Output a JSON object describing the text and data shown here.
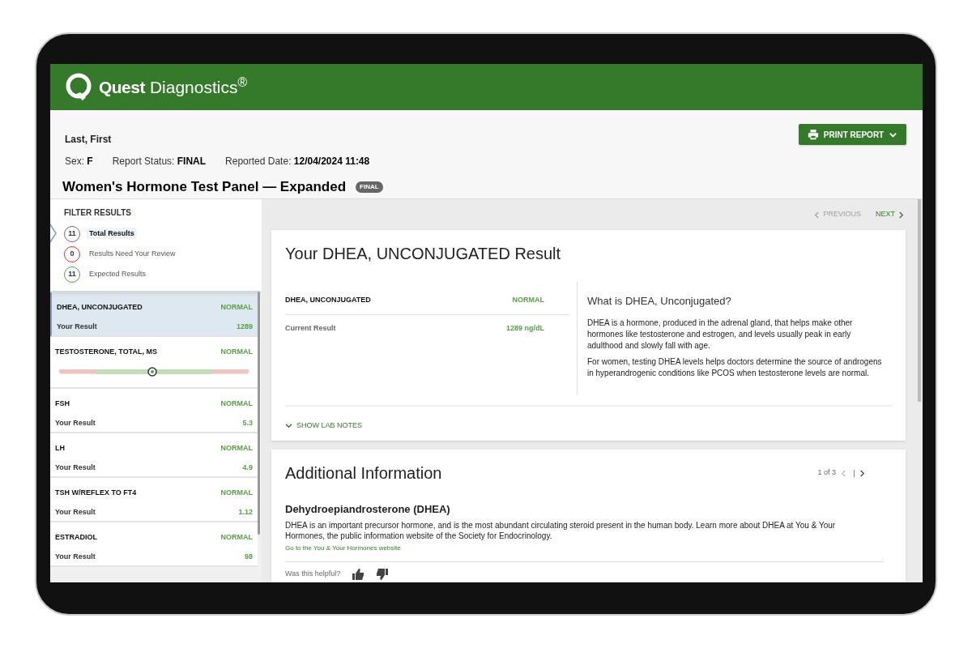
{
  "header": {
    "brand_bold": "Quest",
    "brand_light": "Diagnostics$^{®}$"
  },
  "patient": {
    "name": "Last, First",
    "fields": [
      {
        "label": "Sex:",
        "value": "F"
      },
      {
        "label": "Report Status:",
        "value": "FINAL"
      },
      {
        "label": "Reported Date:",
        "value": "12/04/2024 11:48"
      }
    ],
    "print_button": "PRINT REPORT",
    "title": "Women's Hormone Test Panel — Expanded",
    "badge": "FINAL"
  },
  "filter": {
    "heading": "FILTER RESULTS",
    "items": [
      {
        "count": "11",
        "label": "Total Results",
        "color": "#6b6b6b",
        "selected": true
      },
      {
        "count": "0",
        "label": "Results Need Your Review",
        "color": "#d32f2f",
        "selected": false
      },
      {
        "count": "11",
        "label": "Expected Results",
        "color": "#5a9e47",
        "selected": false
      }
    ]
  },
  "results": [
    {
      "kind": "value",
      "name": "DHEA, UNCONJUGATED",
      "status": "NORMAL",
      "label": "Your Result",
      "value": "1289",
      "selected": true
    },
    {
      "kind": "range",
      "name": "TESTOSTERONE, TOTAL, MS",
      "status": "NORMAL",
      "level": 0.49,
      "selected": false
    },
    {
      "kind": "value",
      "name": "FSH",
      "status": "NORMAL",
      "label": "Your Result",
      "value": "5.3",
      "selected": false
    },
    {
      "kind": "value",
      "name": "LH",
      "status": "NORMAL",
      "label": "Your Result",
      "value": "4.9",
      "selected": false
    },
    {
      "kind": "value",
      "name": "TSH W/REFLEX TO FT4",
      "status": "NORMAL",
      "label": "Your Result",
      "value": "1.12",
      "selected": false
    },
    {
      "kind": "value",
      "name": "ESTRADIOL",
      "status": "NORMAL",
      "label": "Your Result",
      "value": "98",
      "selected": false
    }
  ],
  "nav": {
    "previous": {
      "label": "PREVIOUS",
      "disabled": true
    },
    "next": {
      "label": "NEXT",
      "disabled": false
    }
  },
  "result_card": {
    "title": "Your DHEA, UNCONJUGATED Result",
    "test_name": "DHEA, UNCONJUGATED",
    "status": "NORMAL",
    "current_label": "Current Result",
    "current_value": "1289 ng/dL",
    "info_title": "What is DHEA, Unconjugated?",
    "paragraphs": [
      "DHEA is a hormone, produced in the adrenal gland, that helps make other hormones like testosterone and estrogen, and levels usually peak in early adulthood and slowly fall with age.",
      "For women, testing DHEA levels helps doctors determine the source of androgens in hyperandrogenic conditions like PCOS when testosterone levels are normal."
    ],
    "show_notes": "SHOW LAB NOTES"
  },
  "additional": {
    "title": "Additional Information",
    "pager": "1 of 3",
    "heading": "Dehydroepiandrosterone (DHEA)",
    "paragraph": "DHEA is an important precursor hormone, and is the most abundant circulating steroid present in the human body. Learn more about DHEA at You & Your Hormones, the public information website of the Society for Endocrinology.",
    "link": "Go to the You & Your Hormones website",
    "helpful": "Was this helpful?"
  }
}
